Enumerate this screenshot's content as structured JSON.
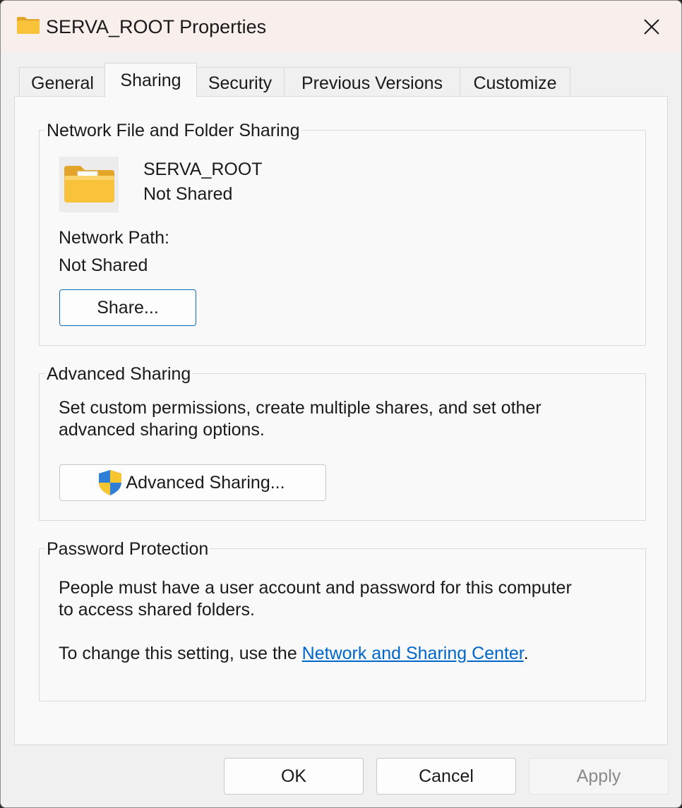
{
  "window": {
    "title": "SERVA_ROOT Properties"
  },
  "icons": {
    "title": "folder-icon",
    "close": "close-icon",
    "folder_large": "shared-folder-icon",
    "shield": "uac-shield-icon"
  },
  "tabs": [
    {
      "label": "General",
      "active": false
    },
    {
      "label": "Sharing",
      "active": true
    },
    {
      "label": "Security",
      "active": false
    },
    {
      "label": "Previous Versions",
      "active": false
    },
    {
      "label": "Customize",
      "active": false
    }
  ],
  "network_sharing": {
    "legend": "Network File and Folder Sharing",
    "folder_name": "SERVA_ROOT",
    "folder_status": "Not Shared",
    "path_label": "Network Path:",
    "path_value": "Not Shared",
    "share_button": "Share..."
  },
  "advanced_sharing": {
    "legend": "Advanced Sharing",
    "description_line1": "Set custom permissions, create multiple shares, and set other",
    "description_line2": "advanced sharing options.",
    "button": "Advanced Sharing..."
  },
  "password_protection": {
    "legend": "Password Protection",
    "description_line1": "People must have a user account and password for this computer",
    "description_line2": "to access shared folders.",
    "change_prefix": "To change this setting, use the ",
    "change_link": "Network and Sharing Center",
    "change_suffix": "."
  },
  "footer": {
    "ok": "OK",
    "cancel": "Cancel",
    "apply": "Apply",
    "apply_enabled": false
  },
  "colors": {
    "accent": "#0f6cbd",
    "link": "#0066cc",
    "titlebar": "#f8eeec",
    "folder": "#f8c33b"
  }
}
